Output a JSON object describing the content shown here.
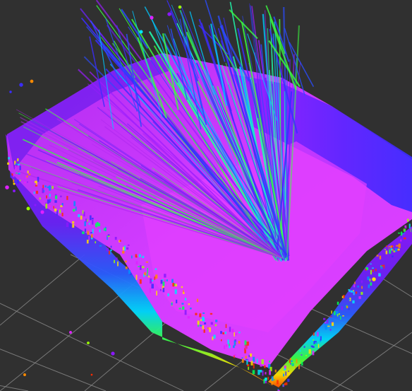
{
  "viewer": {
    "background_color": "#303030",
    "grid_color": "#8a8a8a",
    "colormap": [
      "#ff2a00",
      "#ff8a00",
      "#ffe000",
      "#9bff00",
      "#00ff5a",
      "#00e5ff",
      "#0090ff",
      "#3a2cff",
      "#8a18ff",
      "#e020ff"
    ]
  },
  "point_cloud": {
    "shape": "room-scan",
    "dominant_color": "#c028f0",
    "floor_color": "#e03cff",
    "wall_colors": [
      "#6a22f8",
      "#3b2cff",
      "#0088ff",
      "#00e0c0",
      "#3cff40",
      "#ffe000",
      "#ff5a00"
    ]
  }
}
